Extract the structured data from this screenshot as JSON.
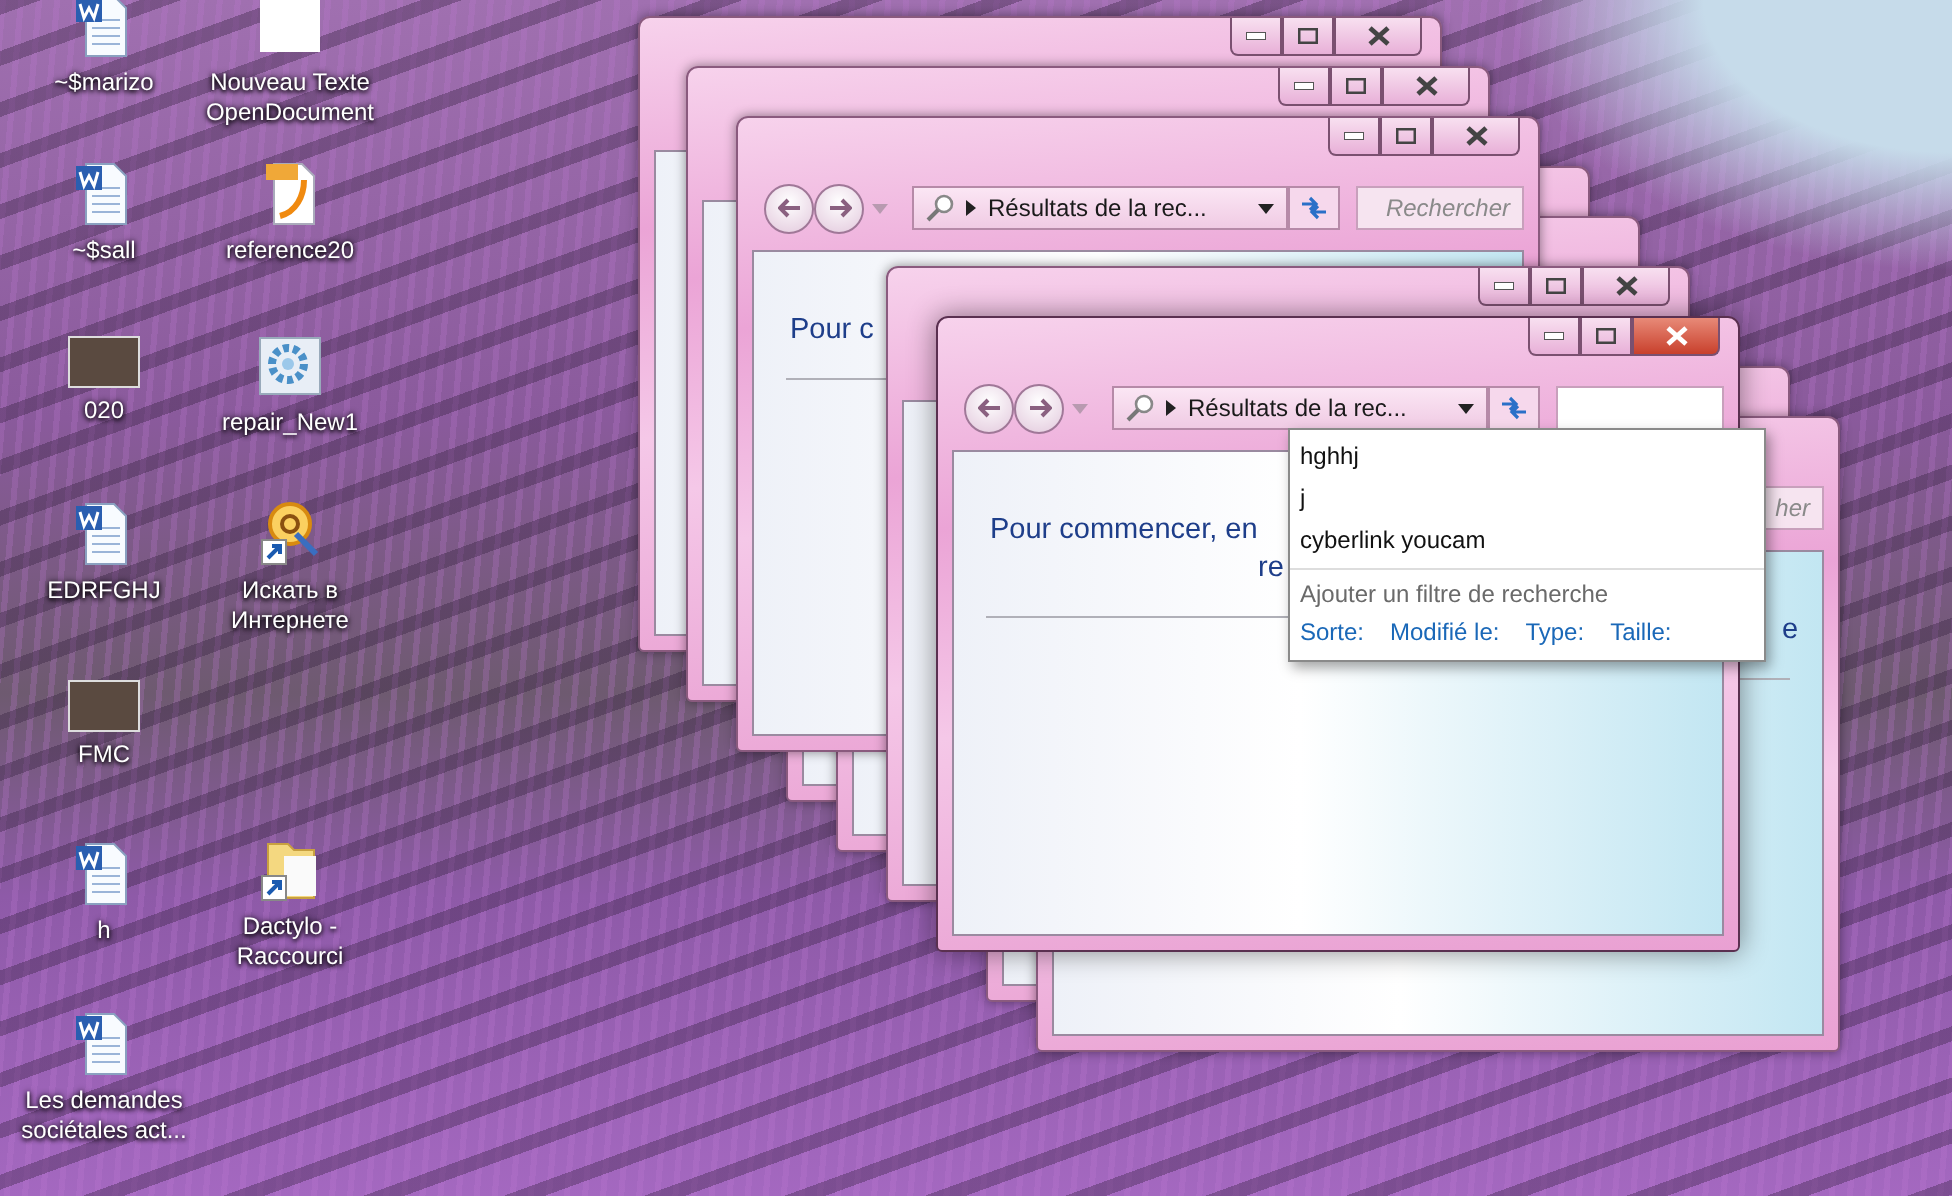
{
  "desktop_icons": [
    {
      "label": "~$marizo",
      "kind": "word"
    },
    {
      "label": "Nouveau Texte OpenDocument",
      "kind": "blank"
    },
    {
      "label": "~$sall",
      "kind": "word"
    },
    {
      "label": "reference20",
      "kind": "pdf"
    },
    {
      "label": "020",
      "kind": "photo"
    },
    {
      "label": "repair_New1",
      "kind": "gear"
    },
    {
      "label": "EDRFGHJ",
      "kind": "word"
    },
    {
      "label": "Искать в Интернете",
      "kind": "web-shortcut"
    },
    {
      "label": "FMC",
      "kind": "photo"
    },
    {
      "label": "h",
      "kind": "word"
    },
    {
      "label": "Dactylo - Raccourci",
      "kind": "folder-shortcut"
    },
    {
      "label": "Les demandes sociétales act...",
      "kind": "word"
    }
  ],
  "windows": [
    {
      "title_buttons": true,
      "focused": false
    },
    {
      "title_buttons": true,
      "focused": false
    },
    {
      "title_buttons": false
    },
    {
      "title_buttons": false
    },
    {
      "title_buttons": true,
      "focused": false,
      "address": "Résultats de la rec...",
      "search_placeholder": "Rechercher",
      "content_lines": [
        "Pour c"
      ]
    },
    {
      "title_buttons": true,
      "focused": false
    },
    {
      "title_buttons": false
    },
    {
      "title_buttons": false,
      "search_placeholder": "her",
      "content_lines": [
        "e"
      ]
    },
    {
      "title_buttons": true,
      "focused": true,
      "address": "Résultats de la rec...",
      "content_lines": [
        "Pour commencer, en",
        "re"
      ]
    }
  ],
  "search_suggestions": {
    "items": [
      "hghhj",
      "j",
      "cyberlink youcam"
    ],
    "filter_hint": "Ajouter un filtre de recherche",
    "filters": [
      "Sorte:",
      "Modifié le:",
      "Type:",
      "Taille:"
    ]
  }
}
